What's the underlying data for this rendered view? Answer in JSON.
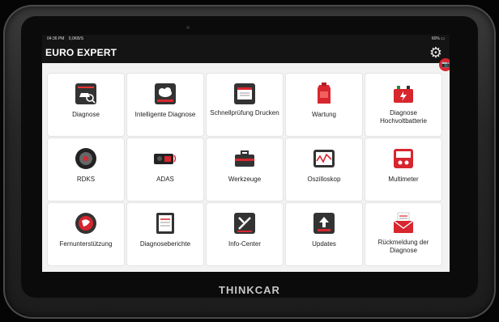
{
  "brand": "THINKCAR",
  "status_bar": {
    "time": "04:36 PM",
    "network": "0,0KB/S",
    "battery": "60%"
  },
  "app": {
    "title": "EURO EXPERT"
  },
  "tiles": [
    {
      "label": "Diagnose",
      "icon": "car-magnifier-icon"
    },
    {
      "label": "Intelligente Diagnose",
      "icon": "cloud-diagnosis-icon"
    },
    {
      "label": "Schnellprüfung Drucken",
      "icon": "print-report-icon"
    },
    {
      "label": "Wartung",
      "icon": "oil-can-icon"
    },
    {
      "label": "Diagnose Hochvoltbatterie",
      "icon": "hv-battery-icon"
    },
    {
      "label": "RDKS",
      "icon": "tire-icon"
    },
    {
      "label": "ADAS",
      "icon": "adas-camera-icon"
    },
    {
      "label": "Werkzeuge",
      "icon": "toolbox-icon"
    },
    {
      "label": "Oszilloskop",
      "icon": "oscilloscope-icon"
    },
    {
      "label": "Multimeter",
      "icon": "multimeter-icon"
    },
    {
      "label": "Fernunterstützung",
      "icon": "remote-globe-icon"
    },
    {
      "label": "Diagnoseberichte",
      "icon": "report-document-icon"
    },
    {
      "label": "Info-Center",
      "icon": "info-center-icon"
    },
    {
      "label": "Updates",
      "icon": "upload-icon"
    },
    {
      "label": "Rückmeldung der Diagnose",
      "icon": "feedback-envelope-icon"
    }
  ],
  "colors": {
    "accent": "#d7262e",
    "appbar": "#141414",
    "background": "#f2f2f2"
  }
}
